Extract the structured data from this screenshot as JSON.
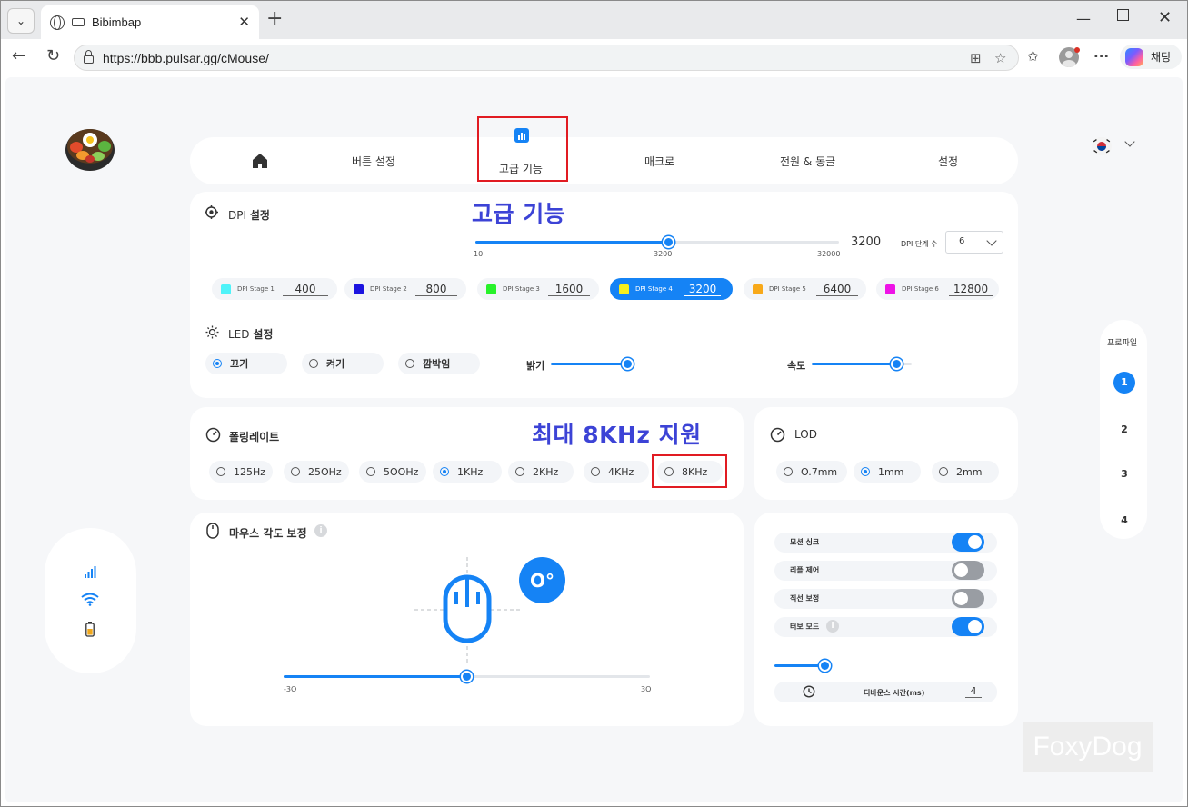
{
  "browser": {
    "tab_title": "Bibimbap",
    "url": "https://bbb.pulsar.gg/cMouse/",
    "copilot_label": "채팅"
  },
  "nav": {
    "items": [
      "버튼 설정",
      "고급 기능",
      "매크로",
      "전원 & 동글",
      "설정"
    ]
  },
  "annotations": {
    "advanced_title": "고급 기능",
    "polling_note": "최대 8KHz 지원"
  },
  "dpi": {
    "title_prefix": "DPI ",
    "title_bold": "설정",
    "slider_ticks": [
      "10",
      "3200",
      "32000"
    ],
    "slider_value": 3200,
    "slider_min": 10,
    "slider_max": 32000,
    "value_display": "3200",
    "steps_label": "DPI 단계 수",
    "steps_value": "6",
    "stages": [
      {
        "label": "DPI Stage  1",
        "value": "400",
        "color": "#4ff3f9",
        "active": false
      },
      {
        "label": "DPI Stage  2",
        "value": "800",
        "color": "#1c14e0",
        "active": false
      },
      {
        "label": "DPI Stage  3",
        "value": "1600",
        "color": "#28f22a",
        "active": false
      },
      {
        "label": "DPI Stage  4",
        "value": "3200",
        "color": "#f6ee1d",
        "active": true
      },
      {
        "label": "DPI Stage  5",
        "value": "6400",
        "color": "#f8a91a",
        "active": false
      },
      {
        "label": "DPI Stage  6",
        "value": "12800",
        "color": "#ee13e6",
        "active": false
      }
    ]
  },
  "led": {
    "title_prefix": "LED ",
    "title_bold": "설정",
    "modes": [
      "끄기",
      "켜기",
      "깜박임"
    ],
    "selected_mode": "끄기",
    "brightness_label": "밝기",
    "brightness_level": 1.0,
    "speed_label": "속도",
    "speed_level": 0.85
  },
  "polling": {
    "title": "폴링레이트",
    "options": [
      "125Hz",
      "25OHz",
      "5OOHz",
      "1KHz",
      "2KHz",
      "4KHz",
      "8KHz"
    ],
    "selected": "1KHz"
  },
  "lod": {
    "title": "LOD",
    "options": [
      "O.7mm",
      "1mm",
      "2mm"
    ],
    "selected": "1mm"
  },
  "angle": {
    "title": "마우스 각도 보정",
    "value_display": "O°",
    "min_label": "-3O",
    "max_label": "3O",
    "value": 0
  },
  "toggles": [
    {
      "label": "모션 싱크",
      "on": true
    },
    {
      "label": "리플 제어",
      "on": false
    },
    {
      "label": "직선 보정",
      "on": false
    },
    {
      "label": "터보 모드",
      "on": true
    }
  ],
  "debounce": {
    "label": "디바운스 시간(ms)",
    "value": "4",
    "slider_level": 0.25
  },
  "profile": {
    "label": "프로파일",
    "items": [
      "1",
      "2",
      "3",
      "4"
    ],
    "active": "1"
  },
  "watermark": "FoxyDog",
  "colors": {
    "accent": "#1583f5",
    "annotation_box": "#e11b22",
    "annotation_text": "#3c43d6"
  }
}
